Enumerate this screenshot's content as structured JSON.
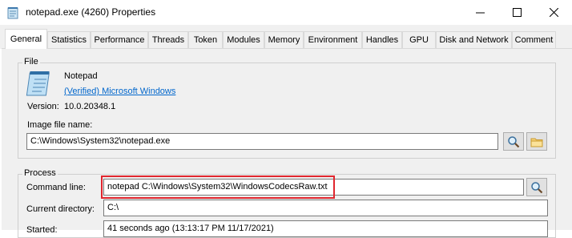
{
  "window": {
    "title": "notepad.exe (4260) Properties",
    "controls": {
      "minimize": "minimize",
      "maximize": "maximize",
      "close": "close"
    }
  },
  "tabs": [
    "General",
    "Statistics",
    "Performance",
    "Threads",
    "Token",
    "Modules",
    "Memory",
    "Environment",
    "Handles",
    "GPU",
    "Disk and Network",
    "Comment"
  ],
  "active_tab": "General",
  "file_group": {
    "title": "File",
    "name": "Notepad",
    "verified": "(Verified) Microsoft Windows",
    "version_label": "Version:",
    "version_value": "10.0.20348.1",
    "image_label": "Image file name:",
    "image_value": "C:\\Windows\\System32\\notepad.exe"
  },
  "process_group": {
    "title": "Process",
    "cmd_label": "Command line:",
    "cmd_value": "notepad  C:\\Windows\\System32\\WindowsCodecsRaw.txt",
    "cwd_label": "Current directory:",
    "cwd_value": "C:\\",
    "started_label": "Started:",
    "started_value": "41 seconds ago (13:13:17 PM 11/17/2021)"
  },
  "colors": {
    "highlight": "#e0262e",
    "link": "#0066cc"
  },
  "icons": [
    "notepad-app-icon",
    "notepad-large-icon",
    "search-icon",
    "folder-icon"
  ]
}
